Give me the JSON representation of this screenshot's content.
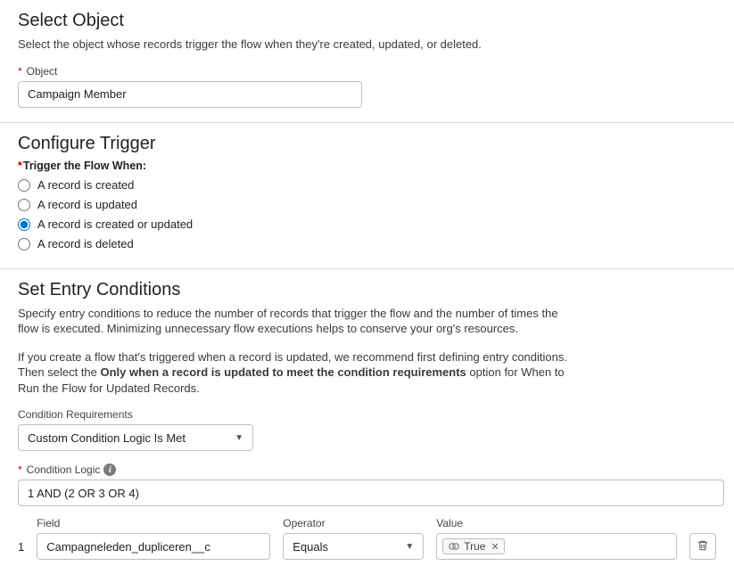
{
  "selectObject": {
    "title": "Select Object",
    "desc": "Select the object whose records trigger the flow when they're created, updated, or deleted.",
    "objectLabel": "Object",
    "objectValue": "Campaign Member"
  },
  "configureTrigger": {
    "title": "Configure Trigger",
    "label": "Trigger the Flow When:",
    "options": {
      "created": "A record is created",
      "updated": "A record is updated",
      "createdOrUpdated": "A record is created or updated",
      "deleted": "A record is deleted"
    },
    "selected": "createdOrUpdated"
  },
  "entryConditions": {
    "title": "Set Entry Conditions",
    "desc1": "Specify entry conditions to reduce the number of records that trigger the flow and the number of times the flow is executed. Minimizing unnecessary flow executions helps to conserve your org's resources.",
    "desc2a": "If you create a flow that's triggered when a record is updated, we recommend first defining entry conditions. Then select the ",
    "desc2bold": "Only when a record is updated to meet the condition requirements",
    "desc2b": " option for When to Run the Flow for Updated Records.",
    "conditionReqLabel": "Condition Requirements",
    "conditionReqValue": "Custom Condition Logic Is Met",
    "conditionLogicLabel": "Condition Logic",
    "conditionLogicValue": "1 AND (2 OR 3 OR 4)",
    "columns": {
      "field": "Field",
      "operator": "Operator",
      "value": "Value"
    },
    "row1": {
      "num": "1",
      "field": "Campagneleden_dupliceren__c",
      "operator": "Equals",
      "valueLabel": "True"
    }
  }
}
